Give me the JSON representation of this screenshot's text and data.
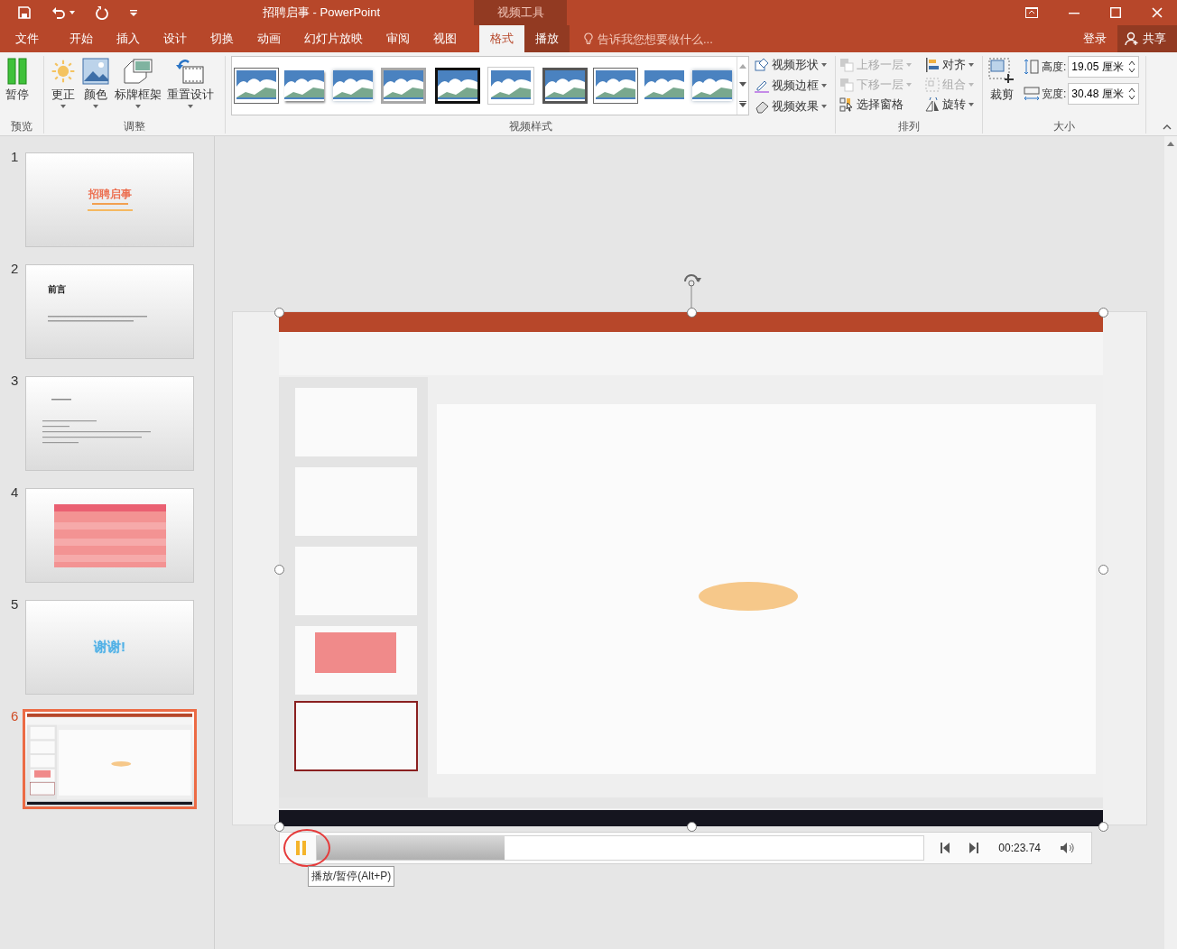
{
  "window": {
    "title": "招聘启事 - PowerPoint",
    "tool_group": "视频工具"
  },
  "tabs": [
    {
      "label": "文件",
      "selected": false,
      "kind": "normal"
    },
    {
      "label": "开始",
      "selected": false,
      "kind": "normal"
    },
    {
      "label": "插入",
      "selected": false,
      "kind": "normal"
    },
    {
      "label": "设计",
      "selected": false,
      "kind": "normal"
    },
    {
      "label": "切换",
      "selected": false,
      "kind": "normal"
    },
    {
      "label": "动画",
      "selected": false,
      "kind": "normal"
    },
    {
      "label": "幻灯片放映",
      "selected": false,
      "kind": "normal"
    },
    {
      "label": "审阅",
      "selected": false,
      "kind": "normal"
    },
    {
      "label": "视图",
      "selected": false,
      "kind": "normal"
    },
    {
      "label": "格式",
      "selected": true,
      "kind": "contextual"
    },
    {
      "label": "播放",
      "selected": false,
      "kind": "contextual"
    }
  ],
  "tell_me": {
    "placeholder": "告诉我您想要做什么..."
  },
  "account": {
    "sign_in": "登录",
    "share": "共享"
  },
  "ribbon": {
    "preview": {
      "title": "预览",
      "buttons": [
        {
          "label": "暂停",
          "kind": "pause"
        }
      ]
    },
    "adjust": {
      "title": "调整",
      "buttons": [
        {
          "label": "更正",
          "kind": "sun",
          "dropdown": true
        },
        {
          "label": "颜色",
          "kind": "picture",
          "dropdown": true
        },
        {
          "label": "标牌框架",
          "kind": "frames",
          "dropdown": true
        },
        {
          "label": "重置设计",
          "kind": "reset",
          "dropdown": true
        }
      ]
    },
    "video_styles": {
      "title": "视频样式",
      "gallery": [
        {
          "kind": "outline"
        },
        {
          "kind": "shadow"
        },
        {
          "kind": "soft"
        },
        {
          "kind": "gray-frame"
        },
        {
          "kind": "black-frame"
        },
        {
          "kind": "white-frame"
        },
        {
          "kind": "dark-frame"
        },
        {
          "kind": "outline"
        },
        {
          "kind": "plain"
        },
        {
          "kind": "soft"
        }
      ],
      "commands": [
        {
          "label": "视频形状",
          "kind": "shape"
        },
        {
          "label": "视频边框",
          "kind": "border"
        },
        {
          "label": "视频效果",
          "kind": "effect"
        }
      ]
    },
    "arrange": {
      "title": "排列",
      "commands": [
        {
          "label": "上移一层",
          "kind": "forward",
          "disabled": true,
          "dropdown": true
        },
        {
          "label": "下移一层",
          "kind": "backward",
          "disabled": true,
          "dropdown": true
        },
        {
          "label": "选择窗格",
          "kind": "pane",
          "disabled": false,
          "dropdown": false
        },
        {
          "label": "对齐",
          "kind": "align",
          "disabled": false,
          "dropdown": true
        },
        {
          "label": "组合",
          "kind": "group",
          "disabled": true,
          "dropdown": true
        },
        {
          "label": "旋转",
          "kind": "rotate",
          "disabled": false,
          "dropdown": true
        }
      ]
    },
    "size": {
      "title": "大小",
      "crop": "裁剪",
      "fields": [
        {
          "label": "高度:",
          "value": "19.05 厘米",
          "kind": "height"
        },
        {
          "label": "宽度:",
          "value": "30.48 厘米",
          "kind": "width"
        }
      ]
    }
  },
  "slides": [
    {
      "number": "1",
      "selected": false,
      "kind": "title",
      "title": "招聘启事"
    },
    {
      "number": "2",
      "selected": false,
      "kind": "heading",
      "title": "前言"
    },
    {
      "number": "3",
      "selected": false,
      "kind": "text"
    },
    {
      "number": "4",
      "selected": false,
      "kind": "table"
    },
    {
      "number": "5",
      "selected": false,
      "kind": "thanks",
      "title": "谢谢!"
    },
    {
      "number": "6",
      "selected": true,
      "kind": "video"
    }
  ],
  "player": {
    "playing": true,
    "highlighted": true,
    "level": 0.31,
    "time": "00:23.74",
    "tooltip": "播放/暂停(Alt+P)"
  }
}
